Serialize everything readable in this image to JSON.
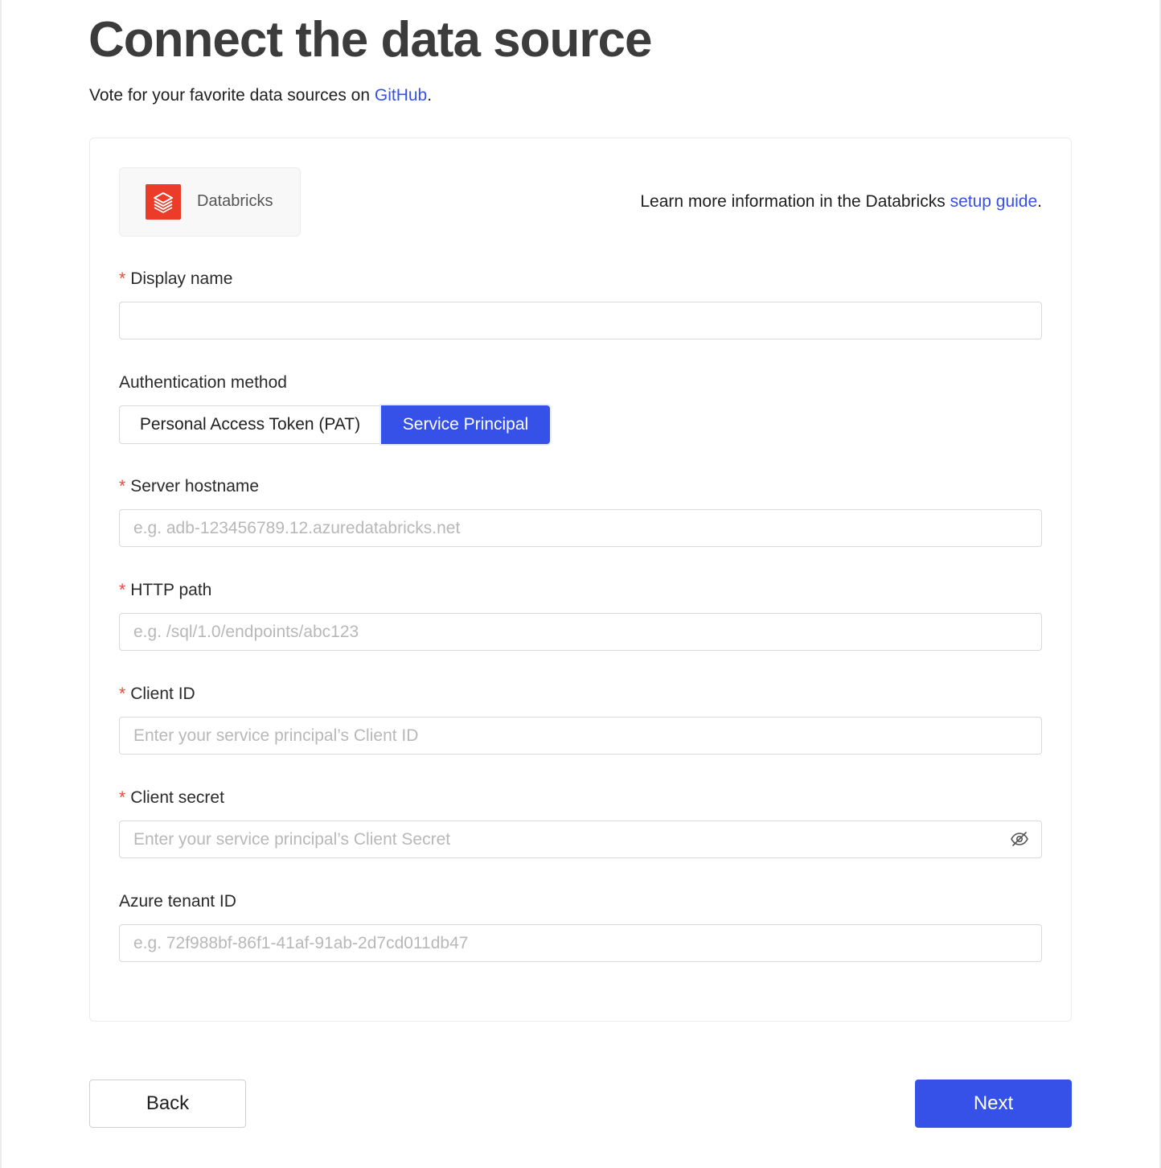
{
  "header": {
    "title": "Connect the data source",
    "subtitle_prefix": "Vote for your favorite data sources on ",
    "subtitle_link": "GitHub",
    "subtitle_suffix": "."
  },
  "source": {
    "name": "Databricks",
    "logo_icon": "databricks-logo-icon",
    "logo_color": "#eb3b29",
    "guide_prefix": "Learn more information in the Databricks ",
    "guide_link": "setup guide",
    "guide_suffix": "."
  },
  "form": {
    "required_mark": "*",
    "display_name": {
      "label": "Display name",
      "value": "",
      "placeholder": ""
    },
    "auth_method": {
      "label": "Authentication method",
      "options": [
        "Personal Access Token (PAT)",
        "Service Principal"
      ],
      "selected": "Service Principal"
    },
    "server_hostname": {
      "label": "Server hostname",
      "placeholder": "e.g. adb-123456789.12.azuredatabricks.net"
    },
    "http_path": {
      "label": "HTTP path",
      "placeholder": "e.g. /sql/1.0/endpoints/abc123"
    },
    "client_id": {
      "label": "Client ID",
      "placeholder": "Enter your service principal’s Client ID"
    },
    "client_secret": {
      "label": "Client secret",
      "placeholder": "Enter your service principal’s Client Secret",
      "toggle_icon": "eye-off-icon"
    },
    "azure_tenant_id": {
      "label": "Azure tenant ID",
      "placeholder": "e.g. 72f988bf-86f1-41af-91ab-2d7cd011db47"
    }
  },
  "footer": {
    "back_label": "Back",
    "next_label": "Next"
  },
  "colors": {
    "accent": "#3651e8",
    "required": "#e5483a",
    "title": "#3c3c3c"
  }
}
